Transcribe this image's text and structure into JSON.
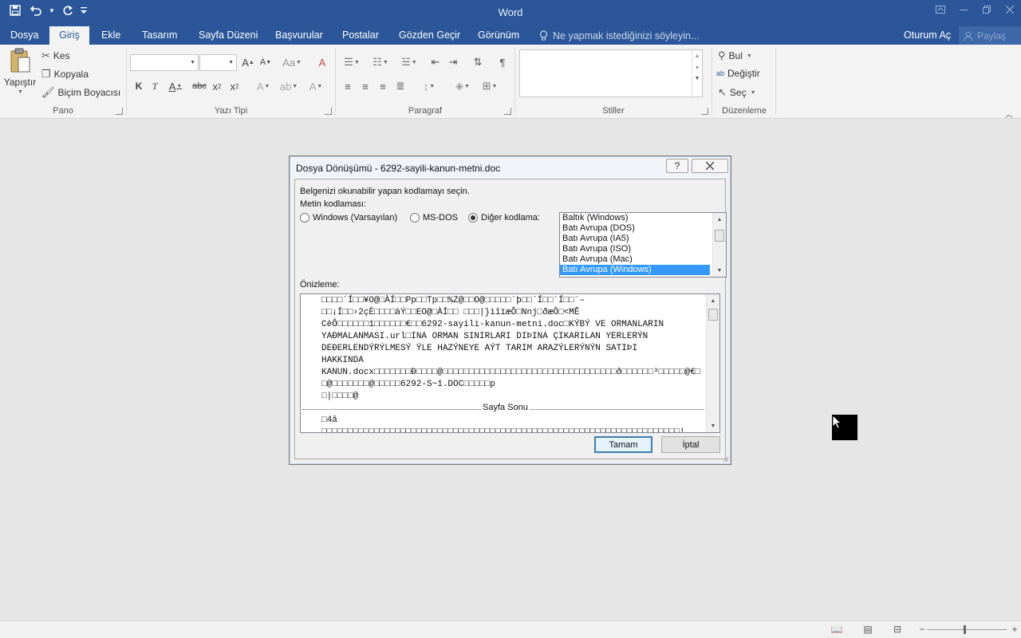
{
  "app": {
    "title": "Word"
  },
  "qat": {
    "save_icon": "save-icon",
    "undo_icon": "undo-icon",
    "redo_icon": "redo-icon"
  },
  "tabs": [
    {
      "label": "Dosya",
      "key": "file"
    },
    {
      "label": "Giriş",
      "key": "home"
    },
    {
      "label": "Ekle",
      "key": "insert"
    },
    {
      "label": "Tasarım",
      "key": "design"
    },
    {
      "label": "Sayfa Düzeni",
      "key": "layout"
    },
    {
      "label": "Başvurular",
      "key": "references"
    },
    {
      "label": "Postalar",
      "key": "mailings"
    },
    {
      "label": "Gözden Geçir",
      "key": "review"
    },
    {
      "label": "Görünüm",
      "key": "view"
    }
  ],
  "tellme": {
    "placeholder": "Ne yapmak istediğinizi söyleyin..."
  },
  "account": {
    "signin": "Oturum Aç",
    "share": "Paylaş"
  },
  "ribbon": {
    "clipboard": {
      "label": "Pano",
      "paste": "Yapıştır",
      "cut": "Kes",
      "copy": "Kopyala",
      "format_painter": "Biçim Boyacısı"
    },
    "font": {
      "label": "Yazı Tipi",
      "font_name": "",
      "font_size": ""
    },
    "paragraph": {
      "label": "Paragraf"
    },
    "styles": {
      "label": "Stiller"
    },
    "editing": {
      "label": "Düzenleme",
      "find": "Bul",
      "replace": "Değiştir",
      "select": "Seç"
    }
  },
  "dialog": {
    "title": "Dosya Dönüşümü - 6292-sayili-kanun-metni.doc",
    "help": "?",
    "instruction": "Belgenizi okunabilir yapan kodlamayı seçin.",
    "encoding_label": "Metin kodlaması:",
    "radios": {
      "windows": "Windows (Varsayılan)",
      "msdos": "MS-DOS",
      "other": "Diğer kodlama:"
    },
    "selected_radio": "other",
    "encodings": [
      "Baltık (Windows)",
      "Batı Avrupa (DOS)",
      "Batı Avrupa (IA5)",
      "Batı Avrupa (ISO)",
      "Batı Avrupa (Mac)",
      "Batı Avrupa (Windows)"
    ],
    "selected_encoding": "Batı Avrupa (Windows)",
    "preview_label": "Önizleme:",
    "preview_lines": [
      "□□□□´Í□□¥O@□ÀÍ□□Pp□□Tp□□%Z@□□O@□□□□□`þ□□´Í□□´Í□□¨–",
      "□□¡Í□□›2çÈ□□□□àÝ□□EO@□ÀÍ□□ □□□|}ìîïæÔ□Nnj□ðæÔ□<MÊ",
      "CèÔ□□□□□□1□□□□□□€□□6292-sayili-kanun-metni.doc□KÝBÝ VE ORMANLARIN",
      "YAÐMALANMASI.url□INA ORMAN SINIRLARI DIÞINA ÇIKARILAN YERLERÝN",
      "DEÐERLENDÝRÝLMESÝ ÝLE HAZÝNEYE AÝT TARIM ARAZÝLERÝNÝN SATIÞI",
      "HAKKINDA",
      "KANUN.docx□□□□□□□Ð□□□□@□□□□□□□□□□□□□□□□□□□□□□□□□□□□□□□□□ð□□□□□□³□□□□□@€□",
      "□@□□□□□□□@□□□□□6292-S~1.DOC□□□□□p",
      "□|□□□□@"
    ],
    "page_break_label": "Sayfa Sonu",
    "preview_after": [
      "□4â",
      "□□□□□□□□□□□□□□□□□□□□□□□□□□□□□□□□□□□□□□□□□□□□□□□□□□□□□□□□□□□□□□□□□□□□!"
    ],
    "ok": "Tamam",
    "cancel": "İptal"
  }
}
